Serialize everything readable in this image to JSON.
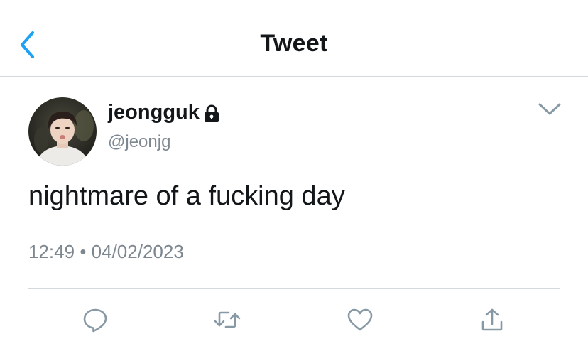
{
  "header": {
    "title": "Tweet",
    "back_icon": "chevron-left-icon",
    "accent_color": "#1da1f2"
  },
  "tweet": {
    "author": {
      "display_name": "jeongguk",
      "handle": "@jeonjg",
      "protected": true,
      "lock_icon": "lock-icon"
    },
    "menu_icon": "chevron-down-icon",
    "text": "nightmare of a fucking day",
    "time": "12:49",
    "separator": "•",
    "date": "04/02/2023"
  },
  "actions": [
    {
      "name": "reply",
      "icon": "reply-icon"
    },
    {
      "name": "retweet",
      "icon": "retweet-icon"
    },
    {
      "name": "like",
      "icon": "heart-icon"
    },
    {
      "name": "share",
      "icon": "share-icon"
    }
  ],
  "colors": {
    "text": "#14171a",
    "secondary": "#7d8790",
    "icon": "#8899a6",
    "divider": "#d5d9dc"
  }
}
